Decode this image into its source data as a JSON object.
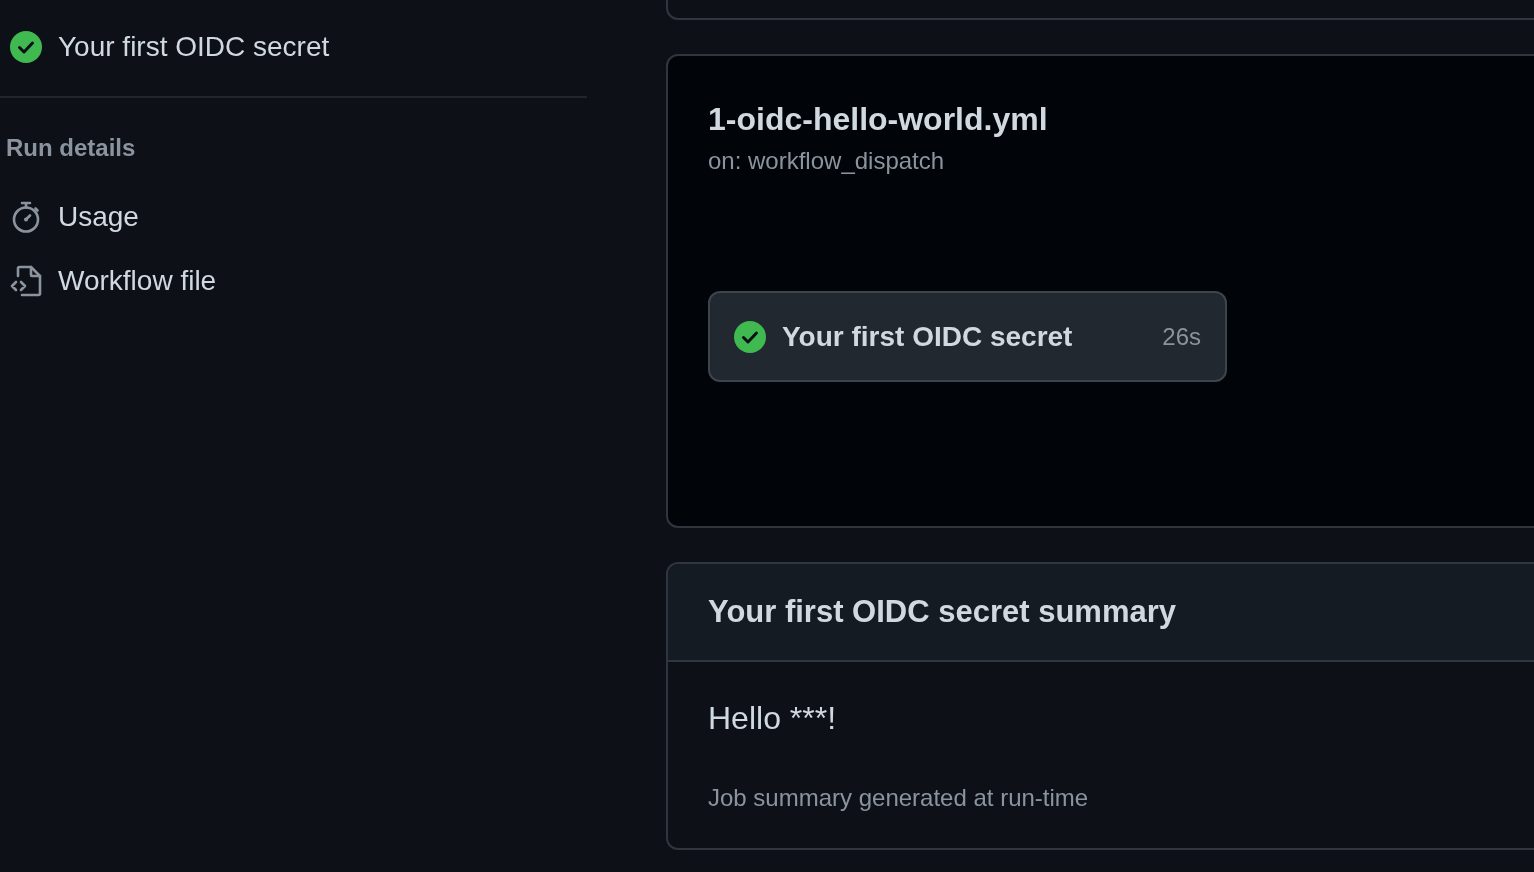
{
  "sidebar": {
    "jobs": [
      {
        "name": "Your first OIDC secret",
        "succeeded": true
      }
    ],
    "section_title": "Run details",
    "links": [
      {
        "label": "Usage",
        "kind": "usage"
      },
      {
        "label": "Workflow file",
        "kind": "workflow_file"
      }
    ]
  },
  "workflow_graph": {
    "file": "1-oidc-hello-world.yml",
    "trigger": "on: workflow_dispatch",
    "jobs": [
      {
        "name": "Your first OIDC secret",
        "succeeded": true,
        "duration": "26s"
      }
    ]
  },
  "summary": {
    "title": "Your first OIDC secret summary",
    "heading": "Hello ***!",
    "footer": "Job summary generated at run-time"
  }
}
